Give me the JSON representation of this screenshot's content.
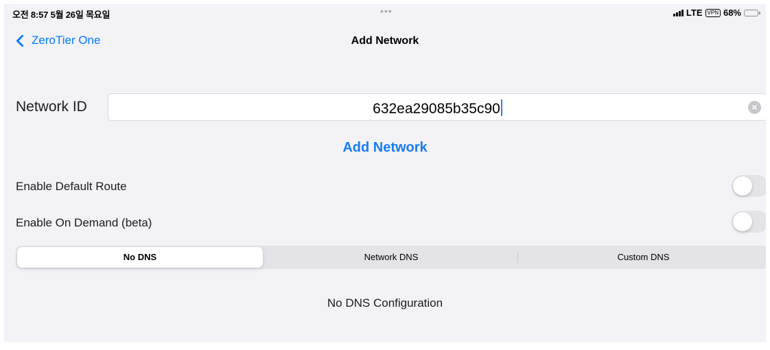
{
  "status_bar": {
    "time_date": "오전 8:57  5월 26일 목요일",
    "dots": "•••",
    "network": "LTE",
    "vpn": "VPN",
    "battery_percent": "68%",
    "battery_level": 0.68
  },
  "nav": {
    "back_label": "ZeroTier One",
    "title": "Add Network"
  },
  "form": {
    "network_id_label": "Network ID",
    "network_id_value": "632ea29085b35c90",
    "clear_icon": "×",
    "add_button_label": "Add Network"
  },
  "toggles": [
    {
      "label": "Enable Default Route",
      "on": false
    },
    {
      "label": "Enable On Demand (beta)",
      "on": false
    }
  ],
  "dns_segments": {
    "options": [
      "No DNS",
      "Network DNS",
      "Custom DNS"
    ],
    "selected": "No DNS"
  },
  "dns_status": "No DNS Configuration",
  "colors": {
    "accent": "#007aff",
    "background": "#f2f2f7",
    "toggle_off": "#e3e3e8"
  }
}
